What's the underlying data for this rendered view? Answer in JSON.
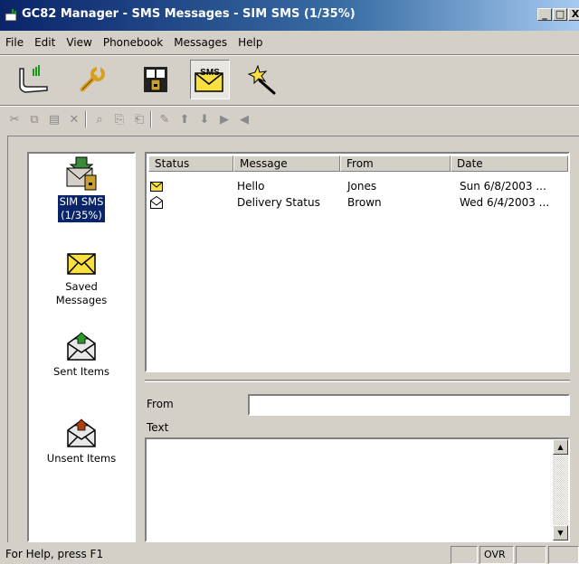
{
  "window": {
    "title": "GC82 Manager - SMS Messages - SIM SMS (1/35%)",
    "minimize_label": "_",
    "restore_label": "□",
    "close_label": "X"
  },
  "menubar": {
    "items": [
      "File",
      "Edit",
      "View",
      "Phonebook",
      "Messages",
      "Help"
    ]
  },
  "main_toolbar": {
    "buttons": [
      {
        "icon": "phone-connect-icon",
        "pressed": false
      },
      {
        "icon": "wrench-settings-icon",
        "pressed": false
      },
      {
        "icon": "phonebook-icon",
        "pressed": false
      },
      {
        "icon": "sms-envelope-icon",
        "pressed": true,
        "icon_text": "SMS"
      },
      {
        "icon": "magic-wand-icon",
        "pressed": false
      }
    ]
  },
  "edit_toolbar": {
    "buttons": [
      "cut-icon",
      "copy-icon",
      "paste-icon",
      "delete-icon",
      "find-icon",
      "copy-to-phone-icon",
      "copy-to-sim-icon",
      "new-message-icon",
      "upload-icon",
      "download-icon",
      "send-icon",
      "receive-icon"
    ]
  },
  "nav": {
    "items": [
      {
        "label_line1": "SIM SMS",
        "label_line2": "(1/35%)",
        "icon": "sim-sms-icon",
        "selected": true
      },
      {
        "label_line1": "Saved",
        "label_line2": "Messages",
        "icon": "saved-messages-icon",
        "selected": false
      },
      {
        "label_line1": "Sent Items",
        "label_line2": "",
        "icon": "sent-items-icon",
        "selected": false
      },
      {
        "label_line1": "Unsent Items",
        "label_line2": "",
        "icon": "unsent-items-icon",
        "selected": false
      }
    ]
  },
  "message_list": {
    "columns": [
      "Status",
      "Message",
      "From",
      "Date"
    ],
    "rows": [
      {
        "status_icon": "unread-envelope-icon",
        "message": "Hello",
        "from": "Jones",
        "date": "Sun 6/8/2003 ..."
      },
      {
        "status_icon": "read-envelope-icon",
        "message": "Delivery Status",
        "from": "Brown",
        "date": "Wed 6/4/2003 ..."
      }
    ]
  },
  "detail": {
    "from_label": "From",
    "from_value": "",
    "text_label": "Text",
    "text_value": ""
  },
  "statusbar": {
    "help_text": "For Help, press F1",
    "ovr": "OVR"
  },
  "colors": {
    "title_start": "#0a246a",
    "title_end": "#a6caf0",
    "selection": "#0a246a",
    "face": "#d4d0c8",
    "envelope_yellow": "#f8e040"
  }
}
